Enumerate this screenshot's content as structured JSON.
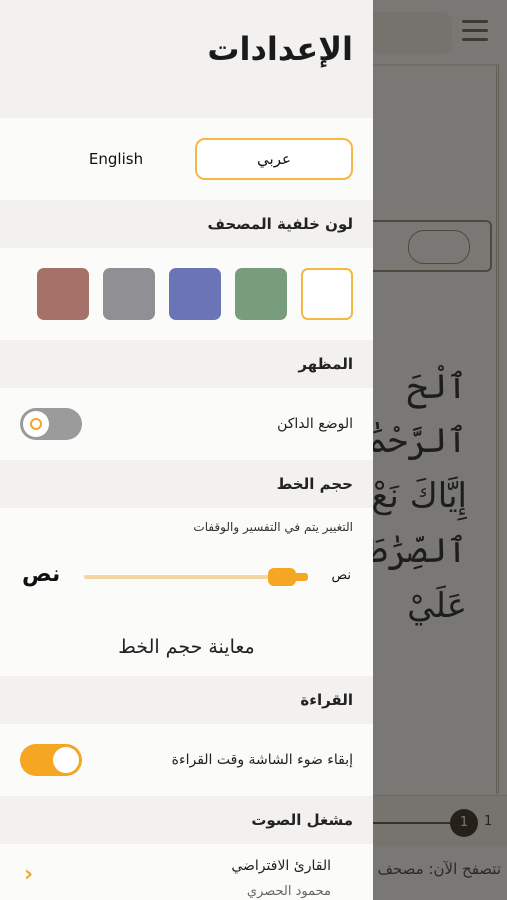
{
  "settings": {
    "title": "الإعدادات",
    "language": {
      "arabic_label": "عربي",
      "english_label": "English",
      "selected": "arabic"
    },
    "background_color": {
      "section_title": "لون خلفية المصحف",
      "swatches": [
        {
          "name": "white",
          "color": "#ffffff",
          "selected": true
        },
        {
          "name": "green",
          "color": "#799d7c",
          "selected": false
        },
        {
          "name": "blue",
          "color": "#6a74b7",
          "selected": false
        },
        {
          "name": "gray",
          "color": "#8f8f94",
          "selected": false
        },
        {
          "name": "red",
          "color": "#a57168",
          "selected": false
        }
      ]
    },
    "appearance": {
      "section_title": "المظهر",
      "dark_mode_label": "الوضع الداكن",
      "dark_mode_on": false
    },
    "font_size": {
      "section_title": "حجم الخط",
      "hint": "التغيير يتم في التفسير والوقفات",
      "small_label": "نص",
      "large_label": "نص",
      "preview_text": "معاينة حجم الخط",
      "level": 0.85
    },
    "reading": {
      "section_title": "القراءة",
      "keep_screen_on_label": "إبقاء ضوء الشاشة وقت القراءة",
      "keep_screen_on": true
    },
    "audio": {
      "section_title": "مشغل الصوت",
      "reader_label": "القارئ الافتراضي",
      "reader_name": "محمود الحصري"
    }
  },
  "background": {
    "page_number": "1",
    "browsing_text": "تتصفح الآن: مصحف",
    "verses": [
      "ٱلْحَ",
      "ٱلرَّحْمَٰنِ",
      "إِيَّاكَ نَعْ",
      "ٱلصِّرَٰطَ",
      "عَلَيْ"
    ]
  },
  "colors": {
    "accent": "#f5a623",
    "accent_border": "#f5b845"
  }
}
